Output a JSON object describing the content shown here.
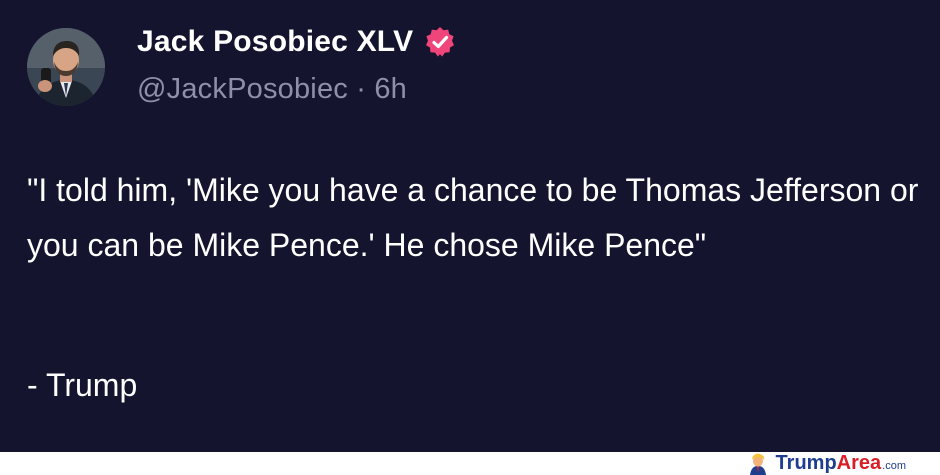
{
  "author": {
    "display_name": "Jack Posobiec XLV",
    "handle": "@JackPosobiec",
    "separator": " · ",
    "time_ago": "6h",
    "verified_color": "#f0457a",
    "avatar_icon": "profile-photo"
  },
  "tweet": {
    "text": "\"I told him, 'Mike you have a chance to be Thomas Jefferson or you can be Mike Pence.' He chose Mike Pence\"",
    "signoff": "- Trump"
  },
  "watermark": {
    "brand_primary": "Trump",
    "brand_secondary": "Area",
    "suffix": ".com",
    "primary_color": "#1f3e8f",
    "secondary_color": "#d61f26"
  },
  "colors": {
    "background": "#14142e",
    "text": "#ffffff",
    "muted_text": "#8f8fa8"
  }
}
